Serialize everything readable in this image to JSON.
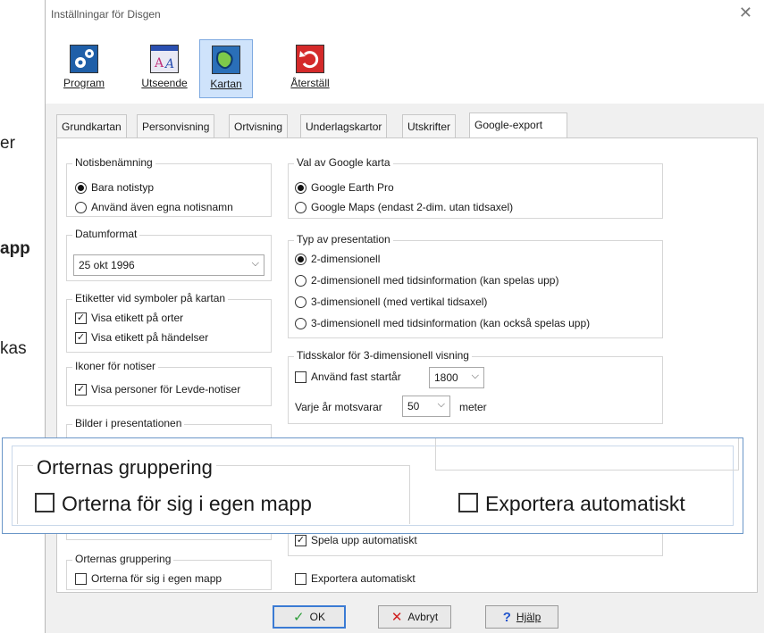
{
  "background_text": {
    "frag1": "er",
    "frag2": "app",
    "frag3": "kas"
  },
  "window": {
    "title": "Inställningar för Disgen",
    "close_glyph": "✕"
  },
  "toolbar": {
    "items": [
      {
        "label": "Program",
        "icon": "gears-icon"
      },
      {
        "label": "Utseende",
        "icon": "fonts-icon"
      },
      {
        "label": "Kartan",
        "icon": "map-icon"
      },
      {
        "label": "Återställ",
        "icon": "undo-icon"
      }
    ]
  },
  "tabs": [
    "Grundkartan",
    "Personvisning",
    "Ortvisning",
    "Underlagskartor",
    "Utskrifter",
    "Google-export"
  ],
  "active_tab": "Google-export",
  "groups": {
    "notis": {
      "caption": "Notisbenämning",
      "opt1": "Bara notistyp",
      "opt2": "Använd även egna notisnamn"
    },
    "datum": {
      "caption": "Datumformat",
      "value": "25 okt 1996"
    },
    "etiketter": {
      "caption": "Etiketter vid symboler på kartan",
      "opt1": "Visa etikett på orter",
      "opt2": "Visa etikett på händelser"
    },
    "ikoner": {
      "caption": "Ikoner för notiser",
      "opt1": "Visa personer för Levde-notiser"
    },
    "bilder": {
      "caption": "Bilder i presentationen"
    },
    "orter": {
      "caption": "Orternas gruppering",
      "opt1": "Orterna för sig i egen mapp"
    },
    "google": {
      "caption": "Val av Google karta",
      "opt1": "Google Earth Pro",
      "opt2": "Google Maps (endast 2-dim. utan tidsaxel)"
    },
    "typ": {
      "caption": "Typ av presentation",
      "opt1": "2-dimensionell",
      "opt2": "2-dimensionell med tidsinformation (kan spelas upp)",
      "opt3": "3-dimensionell (med vertikal tidsaxel)",
      "opt4": "3-dimensionell med tidsinformation (kan också spelas upp)"
    },
    "tidsskalor": {
      "caption": "Tidsskalor för 3-dimensionell visning",
      "fast_label": "Använd fast startår",
      "fast_value": "1800",
      "varje_label": "Varje år motsvarar",
      "varje_value": "50",
      "unit": "meter"
    },
    "spela": {
      "label": "Spela upp  automatiskt"
    },
    "exportera": {
      "label": "Exportera automatiskt"
    }
  },
  "zoom": {
    "caption": "Orternas gruppering",
    "left": "Orterna för sig i egen mapp",
    "right": "Exportera automatiskt"
  },
  "buttons": {
    "ok": "OK",
    "cancel": "Avbryt",
    "help": "Hjälp"
  },
  "colors": {
    "selected_toolbar_bg": "#cfe3fb",
    "ok_check": "#2e9e3a",
    "cancel_x": "#d02020",
    "help_q": "#2255cc"
  }
}
